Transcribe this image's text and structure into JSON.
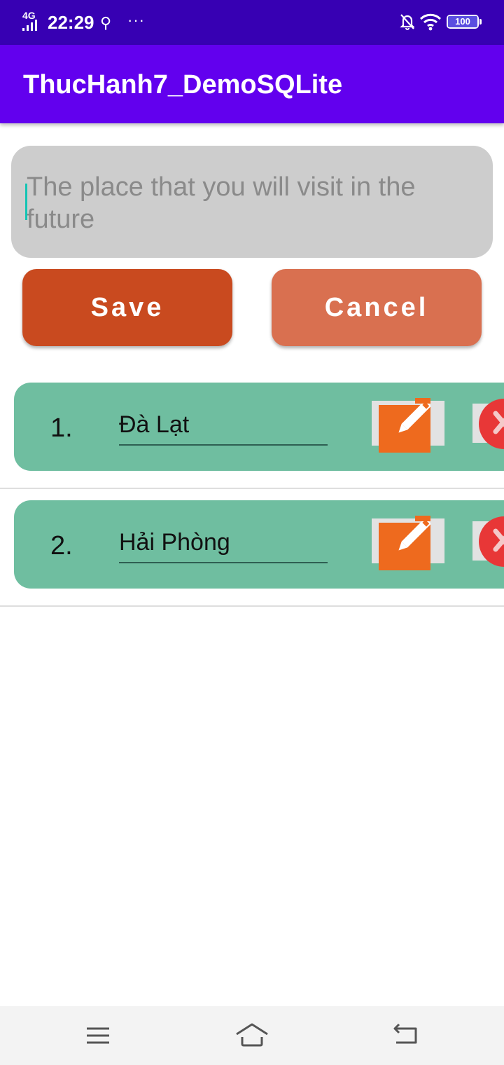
{
  "status_bar": {
    "network": "4G",
    "time": "22:29",
    "more": "···",
    "battery": "100"
  },
  "app": {
    "title": "ThucHanh7_DemoSQLite"
  },
  "form": {
    "placeholder": "The place that you will visit in the future",
    "value": "",
    "save_label": "Save",
    "cancel_label": "Cancel"
  },
  "places": [
    {
      "index": "1.",
      "name": "Đà Lạt"
    },
    {
      "index": "2.",
      "name": "Hải Phòng"
    }
  ],
  "colors": {
    "status_bar": "#3700b3",
    "app_bar": "#6200ee",
    "save_button": "#c94a1f",
    "cancel_button": "#d97050",
    "card": "#6fbea0",
    "edit_icon": "#ee6a1e",
    "delete_icon": "#e83737"
  },
  "icons": {
    "edit": "pencil-edit-icon",
    "delete": "close-circle-icon",
    "nav_menu": "menu-icon",
    "nav_home": "home-icon",
    "nav_back": "back-icon"
  }
}
